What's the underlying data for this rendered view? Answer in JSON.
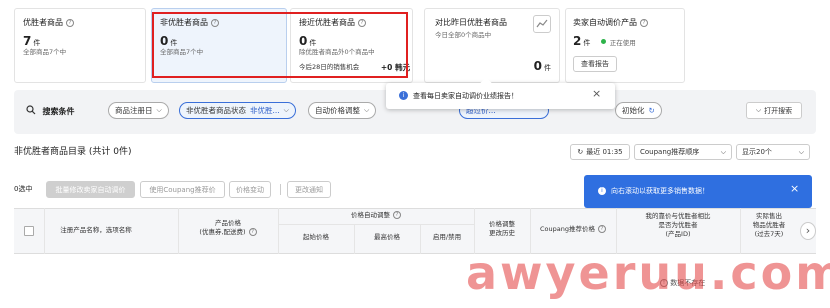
{
  "cards": {
    "c1": {
      "title": "优胜者商品",
      "value": "7",
      "unit": "件",
      "sub": "全部商品7个中"
    },
    "c2": {
      "title": "非优胜者商品",
      "value": "0",
      "unit": "件",
      "sub": "全部商品7个中"
    },
    "c3": {
      "title": "接近优胜者商品",
      "value": "0",
      "unit": "件",
      "sub": "除优胜者商品外0个商品中",
      "sub2": "今后28日的销售机会",
      "amount": "+0 韩元"
    },
    "c4": {
      "title": "对比昨日优胜者商品",
      "sub": "今日全部0个商品中",
      "value": "0",
      "unit": "件"
    },
    "c5": {
      "title": "卖家自动调价产品",
      "value": "2",
      "unit": "件",
      "status": "正在使用",
      "button": "查看报告"
    }
  },
  "tooltip_report": {
    "text": "查看每日卖家自动调价业绩报告！",
    "close": "×"
  },
  "search": {
    "label": "搜索条件",
    "filter_reg": "商品注册日",
    "filter_status": "非优胜者商品状态",
    "filter_status_value": "非优胜...",
    "filter_price": "自动价格调整",
    "partial1": "超过价...",
    "reset": "初始化",
    "expand": "打开搜索"
  },
  "list": {
    "title": "非优胜者商品目录 (共计 0件)",
    "recent": "最近 01:35",
    "sort": "Coupang推荐顺序",
    "per_page": "显示20个"
  },
  "toolbar": {
    "selected": "0选中",
    "bulk": "批量修改卖家自动调价",
    "coupang_price": "使用Coupang推荐价",
    "price_change": "价格变动",
    "notice": "更改通知"
  },
  "tooltip_scroll": {
    "text": "向右滚动以获取更多销售数据！",
    "close": "×"
  },
  "table": {
    "h_name": "注册产品名称，选项名称",
    "h_price": "产品价格\n(优惠券,配送费)",
    "h_auto": "价格自动调整",
    "h_start": "起始价格",
    "h_max": "最高价格",
    "h_enable": "启用/禁用",
    "h_history": "价格调整\n更改历史",
    "h_coupang": "Coupang推荐价格",
    "h_compare": "我的靠价与优胜者相比\n是否为优胜者\n(产品ID)",
    "h_actual": "实际售出\n物品优胜者\n(过去7天)",
    "empty": "数据不存在",
    "next": "›"
  },
  "watermark": "awyeruu.com"
}
